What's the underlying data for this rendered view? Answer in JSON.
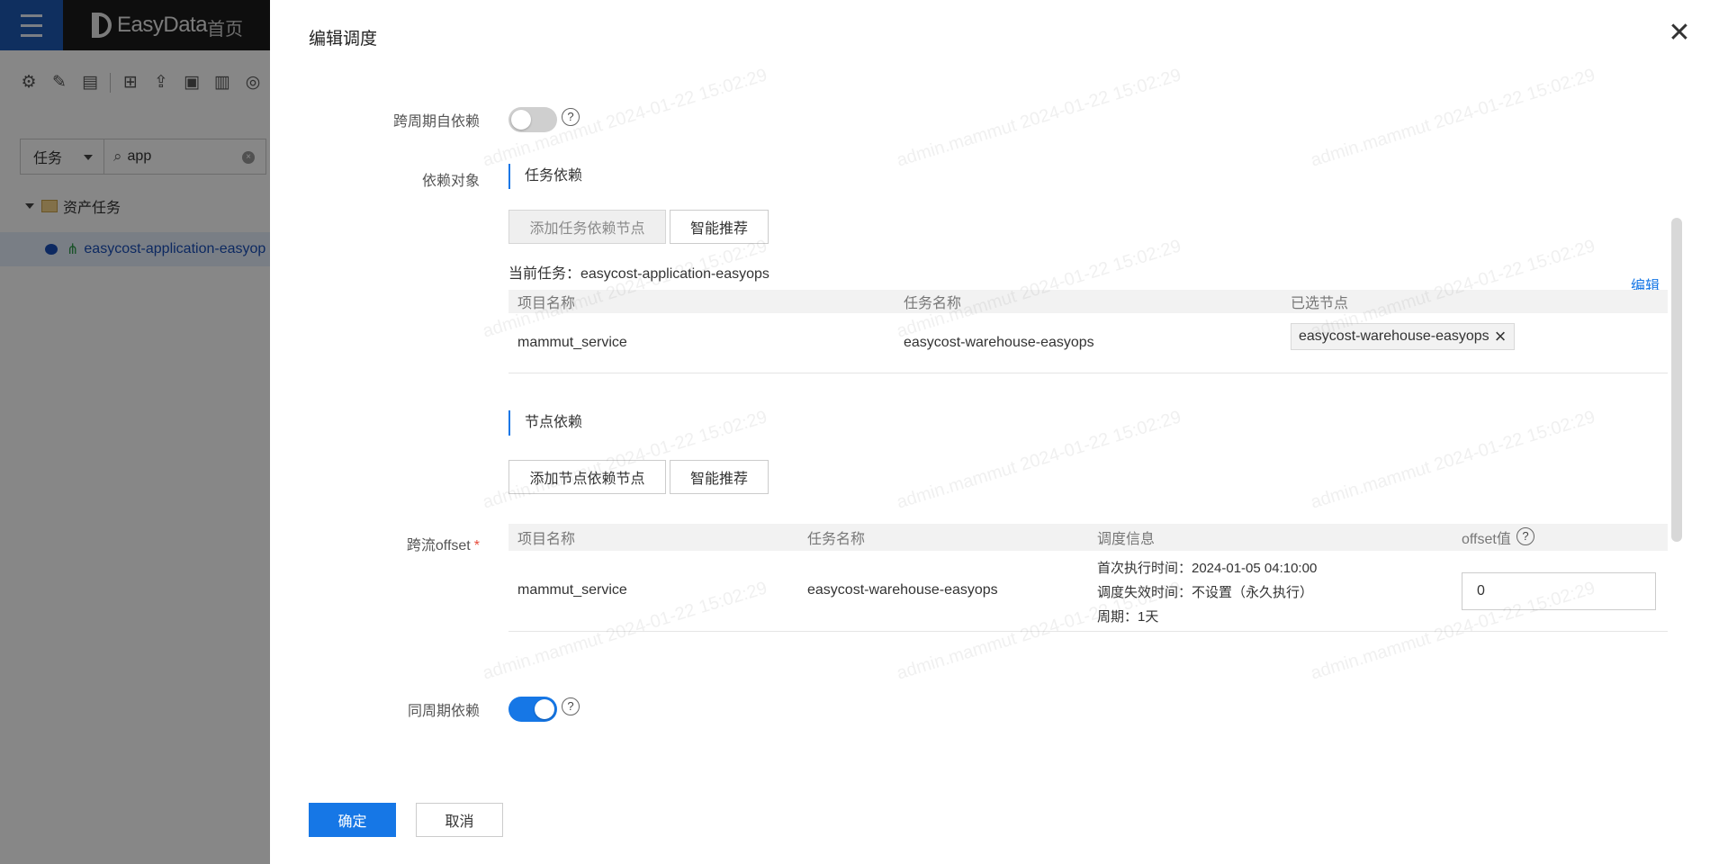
{
  "app": {
    "brand": "EasyData",
    "home_label": "首页"
  },
  "sidebar": {
    "type_select": "任务",
    "search_value": "app",
    "tree_folder": "资产任务",
    "tree_item": "easycost-application-easyop"
  },
  "drawer": {
    "title": "编辑调度",
    "close_label": "✕"
  },
  "form": {
    "cross_cycle_label": "跨周期自依赖",
    "cross_cycle_on": false,
    "depend_label": "依赖对象",
    "task_dep_section": "任务依赖",
    "add_task_dep_button": "添加任务依赖节点",
    "smart_recommend_button": "智能推荐",
    "current_task": "当前任务：easycost-application-easyops",
    "edit_link": "编辑",
    "task_table": {
      "headers": [
        "项目名称",
        "任务名称",
        "已选节点"
      ],
      "rows": [
        {
          "project": "mammut_service",
          "task": "easycost-warehouse-easyops",
          "node": "easycost-warehouse-easyops"
        }
      ]
    },
    "node_dep_section": "节点依赖",
    "add_node_dep_button": "添加节点依赖节点",
    "smart_recommend_button2": "智能推荐",
    "offset_label": "跨流offset",
    "offset_required": "*",
    "offset_table": {
      "headers": [
        "项目名称",
        "任务名称",
        "调度信息",
        "offset值"
      ],
      "rows": [
        {
          "project": "mammut_service",
          "task": "easycost-warehouse-easyops",
          "first_run": "首次执行时间：2024-01-05 04:10:00",
          "expire": "调度失效时间：不设置（永久执行）",
          "period": "周期：1天",
          "offset": "0"
        }
      ]
    },
    "same_cycle_label": "同周期依赖",
    "same_cycle_on": true
  },
  "footer": {
    "confirm_button": "确定",
    "cancel_button": "取消"
  },
  "watermark_text": "admin.mammut 2024-01-22 15:02:29"
}
